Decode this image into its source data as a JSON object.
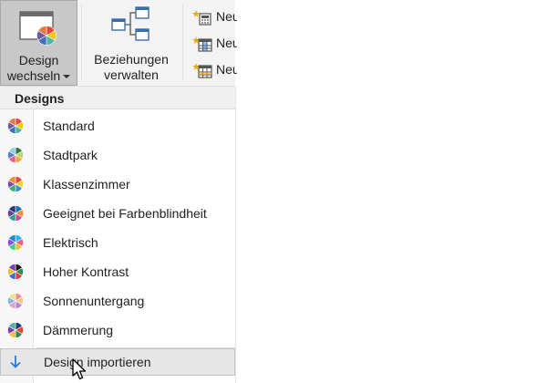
{
  "ribbon": {
    "design_button": {
      "line1": "Design",
      "line2": "wechseln",
      "icon": "design-window-pie-icon"
    },
    "relations_button": {
      "line1": "Beziehungen",
      "line2": "verwalten",
      "icon": "relations-icon"
    },
    "new_buttons": [
      {
        "label": "Neu",
        "icon": "new-measure-icon"
      },
      {
        "label": "Neu",
        "icon": "new-column-icon"
      },
      {
        "label": "Neu",
        "icon": "new-table-icon"
      }
    ]
  },
  "menu": {
    "header": "Designs",
    "items": [
      {
        "label": "Standard",
        "colors": [
          "#e8463a",
          "#f2c80f",
          "#4fb3a6",
          "#3f6fb6",
          "#6d5ca4",
          "#e07a3f"
        ]
      },
      {
        "label": "Stadtpark",
        "colors": [
          "#2f7d3d",
          "#b7d46d",
          "#f2a33a",
          "#e85b8a",
          "#5a7fcf",
          "#8fd0e8"
        ]
      },
      {
        "label": "Klassenzimmer",
        "colors": [
          "#e8463a",
          "#f5d033",
          "#3b8fd6",
          "#3eb06a",
          "#7a4fb0",
          "#f28a2e"
        ]
      },
      {
        "label": "Geeignet bei Farbenblindheit",
        "colors": [
          "#1b6fb3",
          "#f58b2a",
          "#c94b9b",
          "#2a9d8f",
          "#6b3fa0",
          "#1f3a6b"
        ]
      },
      {
        "label": "Elektrisch",
        "colors": [
          "#2ab7e8",
          "#f25a8c",
          "#f2c22e",
          "#3ed07a",
          "#8a4fe0",
          "#1d86d0"
        ]
      },
      {
        "label": "Hoher Kontrast",
        "colors": [
          "#1a1a1a",
          "#2e8b57",
          "#e83a3a",
          "#3a6ee8",
          "#f0c020",
          "#7a3fb0"
        ]
      },
      {
        "label": "Sonnenuntergang",
        "colors": [
          "#f28c8c",
          "#f5c98a",
          "#b58ad6",
          "#e8a0c8",
          "#8ab6e8",
          "#f0e08a"
        ]
      },
      {
        "label": "Dämmerung",
        "colors": [
          "#1f3a6b",
          "#e8463a",
          "#2e8b57",
          "#f2c22e",
          "#7a3fb0",
          "#4fb3a6"
        ]
      }
    ],
    "import_label": "Design importieren",
    "import_icon": "arrow-down-icon"
  },
  "colors": {
    "selected_bg": "#c8c8c8",
    "hover_bg": "#e6e6e6",
    "accent": "#2b7cd3"
  }
}
